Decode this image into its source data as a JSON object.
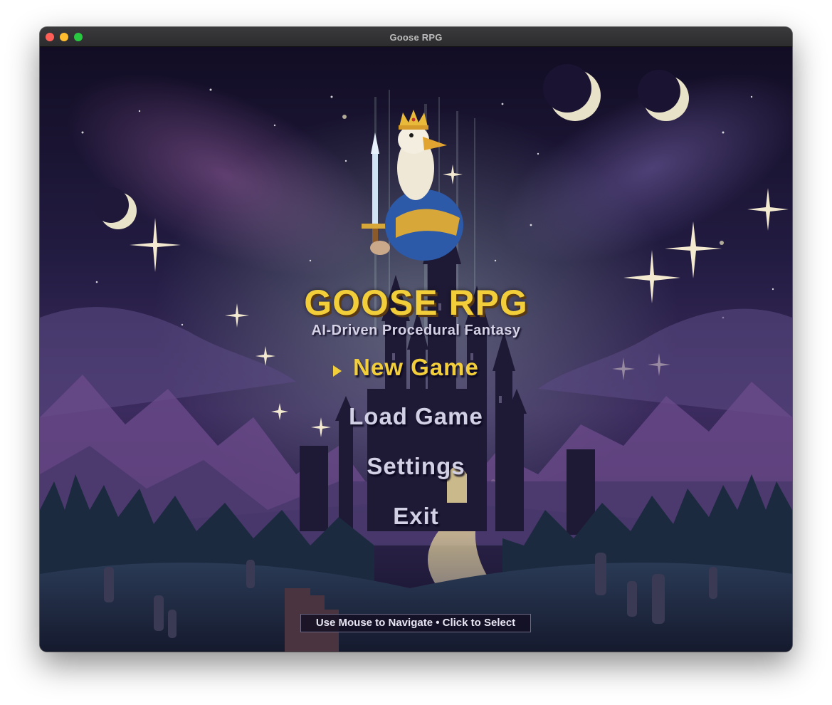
{
  "window": {
    "title": "Goose RPG"
  },
  "game": {
    "title": "GOOSE RPG",
    "subtitle": "AI-Driven Procedural Fantasy"
  },
  "menu": {
    "selected_index": 0,
    "items": [
      {
        "label": "New Game"
      },
      {
        "label": "Load Game"
      },
      {
        "label": "Settings"
      },
      {
        "label": "Exit"
      }
    ]
  },
  "hint": {
    "text": "Use Mouse to Navigate • Click to Select"
  },
  "colors": {
    "accent_gold": "#f2cf3a",
    "menu_text": "#d2d0e4",
    "sky_top": "#120d24",
    "sky_mid": "#2f2752",
    "mountain_purple": "#6a4a8a"
  },
  "icons": {
    "selection_pointer": "triangle-right-icon",
    "mascot": "crowned-goose-knight-icon"
  }
}
